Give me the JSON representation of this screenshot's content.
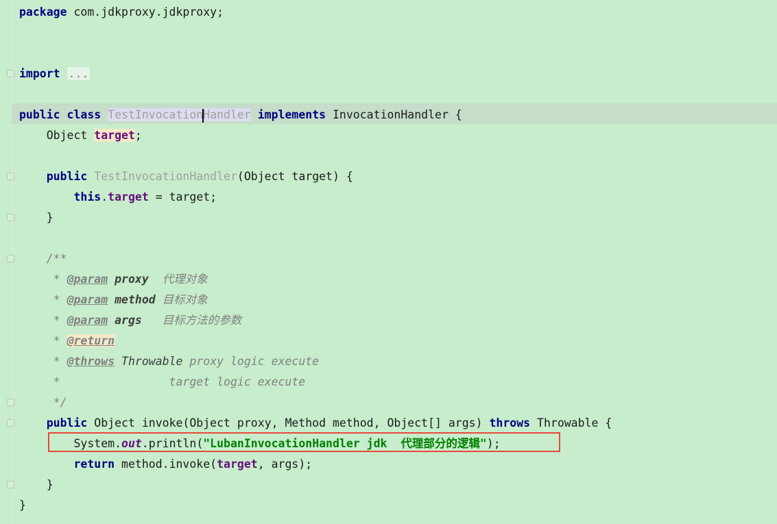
{
  "editor": {
    "lines": {
      "package": {
        "kw": "package",
        "rest": " com.jdkproxy.jdkproxy;"
      },
      "import": {
        "kw": "import",
        "collapsed": "..."
      },
      "class_decl": {
        "kw1": "public",
        "kw2": "class",
        "name_a": "TestInvocation",
        "name_b": "Handler",
        "kw3": "implements",
        "iface": " InvocationHandler {"
      },
      "field_decl": {
        "type": "Object ",
        "name": "target",
        "end": ";"
      },
      "ctor_decl": {
        "kw": "public",
        "name": "TestInvocationHandler",
        "params": "(Object target) {"
      },
      "ctor_body": {
        "kw": "this",
        "dot": ".",
        "field": "target",
        "rest": " = target;"
      },
      "ctor_close": "}",
      "doc_open": "/**",
      "doc_p1": {
        "star": " * ",
        "tag": "@param",
        "name": " proxy",
        "desc": "  代理对象"
      },
      "doc_p2": {
        "star": " * ",
        "tag": "@param",
        "name": " method",
        "desc": " 目标对象"
      },
      "doc_p3": {
        "star": " * ",
        "tag": "@param",
        "name": " args",
        "desc": "   目标方法的参数"
      },
      "doc_ret": {
        "star": " * ",
        "tag": "@return"
      },
      "doc_throws": {
        "star": " * ",
        "tag": "@throws",
        "type": " Throwable",
        "desc": " proxy logic execute"
      },
      "doc_cont": " *                target logic execute",
      "doc_close": " */",
      "invoke_decl": {
        "kw": "public",
        "sig": " Object invoke(Object proxy, Method method, Object[] args) ",
        "kw2": "throws",
        "rest": " Throwable {"
      },
      "println": {
        "pre": "System.",
        "static": "out",
        "call": ".println(",
        "str": "\"LubanInvocationHandler jdk  代理部分的逻辑\"",
        "end": ");"
      },
      "return": {
        "kw": "return",
        "pre": " method.invoke(",
        "field": "target",
        "end": ", args);"
      },
      "invoke_close": "}",
      "class_close": "}"
    }
  },
  "colors": {
    "background": "#c7edcc",
    "keyword": "#000080",
    "field": "#660e7a",
    "string": "#008000",
    "highlight_box": "#e8473a"
  }
}
